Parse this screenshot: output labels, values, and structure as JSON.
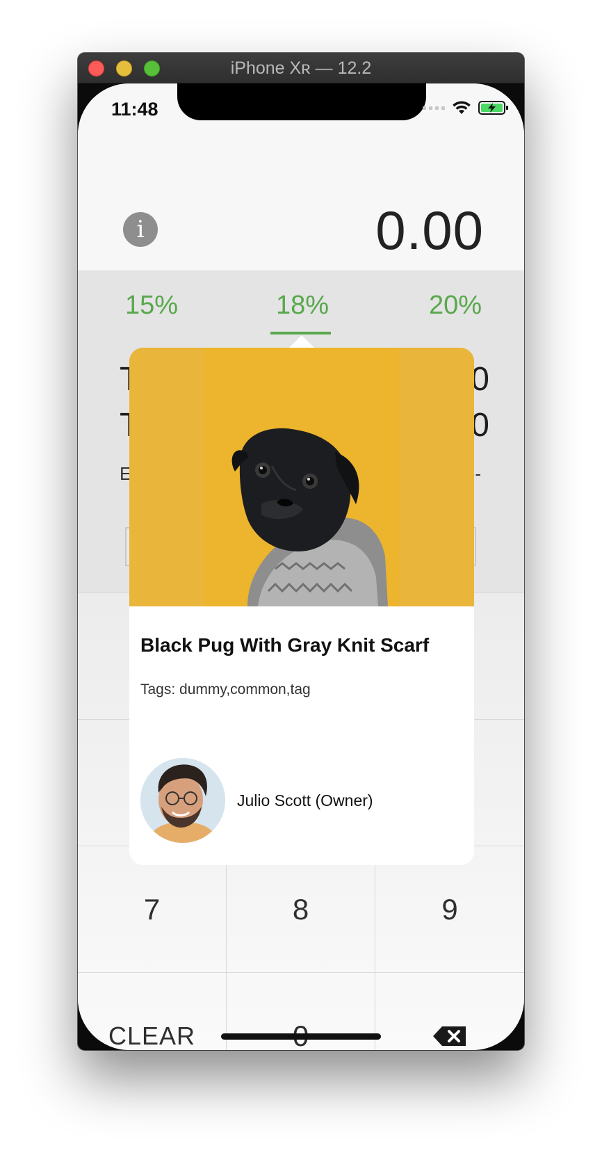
{
  "window": {
    "title": "iPhone Xʀ — 12.2"
  },
  "status_bar": {
    "time": "11:48"
  },
  "header": {
    "info_symbol": "i",
    "amount": "0.00"
  },
  "tips": {
    "options": [
      {
        "label": "15%"
      },
      {
        "label": "18%"
      },
      {
        "label": "20%"
      }
    ],
    "selected": "18%",
    "accent_color": "#59a84c"
  },
  "summary": {
    "line1_fragment": "T",
    "line2_fragment": "T",
    "small_fragment": "E",
    "value1_fragment": "0",
    "value2_fragment": "0",
    "small_value_fragment": "-"
  },
  "keypad": {
    "keys": {
      "seven": "7",
      "eight": "8",
      "nine": "9",
      "clear": "CLEAR",
      "zero": "0"
    },
    "backspace_icon": "backspace-icon"
  },
  "card": {
    "image_description_icon": "pug-photo",
    "image_background": "#ecb52d",
    "title": "Black Pug With Gray Knit Scarf",
    "tags": "Tags: dummy,common,tag",
    "owner": "Julio Scott (Owner)"
  }
}
